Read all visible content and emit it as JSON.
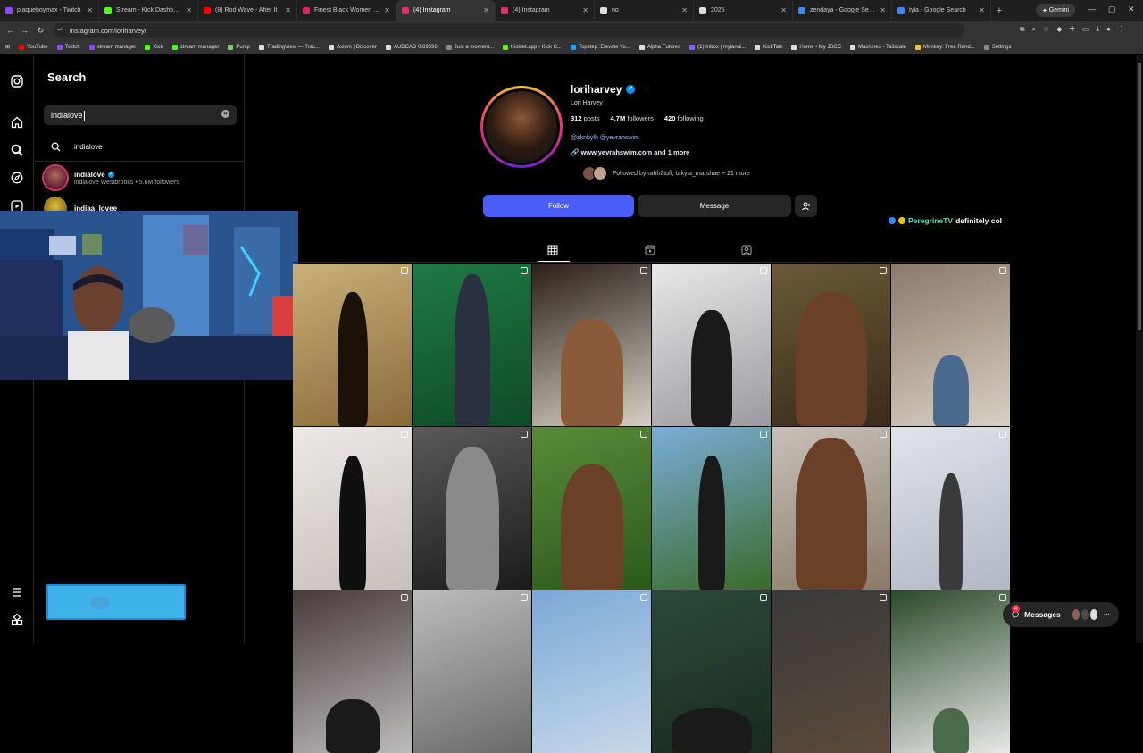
{
  "browser": {
    "tabs": [
      {
        "title": "plaqueboymax - Twitch",
        "color": "#9146ff"
      },
      {
        "title": "Stream - Kick Dashboard",
        "color": "#53fc18"
      },
      {
        "title": "(8) Rod Wave - After It",
        "color": "#ff0000"
      },
      {
        "title": "Finest Black Women | UwU",
        "color": "#e0245e"
      },
      {
        "title": "(4) Instagram",
        "color": "#e1306c"
      },
      {
        "title": "(4) Instagram",
        "color": "#e1306c"
      },
      {
        "title": "rio",
        "color": "#dddddd"
      },
      {
        "title": "2025",
        "color": "#dddddd"
      },
      {
        "title": "zendaya - Google Search",
        "color": "#4285f4"
      },
      {
        "title": "tyla - Google Search",
        "color": "#4285f4"
      }
    ],
    "gemini_label": "Gemini",
    "url": "instagram.com/loriharvey/",
    "bookmarks": [
      "YouTube",
      "Twitch",
      "stream manager",
      "Kick",
      "stream manager",
      "Pump",
      "TradingView — Trac...",
      "Axiom | Discover",
      "AUDCAD 0.89596",
      "Just a moment...",
      "Kicklet.app - Kick C...",
      "Topstep: Elevate Yo...",
      "Alpha Futures",
      "(1) Inbox | mylanai...",
      "KickTalk",
      "Home - My JSCC",
      "Machines - Tailscale",
      "Monkey: Free Rand...",
      "Settings"
    ]
  },
  "search": {
    "title": "Search",
    "query": "indialove",
    "results": [
      {
        "type": "keyword",
        "name": "indialove"
      },
      {
        "type": "user",
        "name": "indialove",
        "sub": "indialove Westbrooks • 5.6M followers",
        "verified": true
      },
      {
        "type": "user",
        "name": "indiaa_lovee",
        "sub": "",
        "verified": false
      }
    ]
  },
  "profile": {
    "username": "loriharvey",
    "full_name": "Lori Harvey",
    "posts": "312",
    "posts_label": "posts",
    "followers": "4.7M",
    "followers_label": "followers",
    "following": "420",
    "following_label": "following",
    "mentions": "@sknbylh @yevrahswim",
    "link": "www.yevrahswim.com and 1 more",
    "followed_by": "Followed by rahh2tuff, takyla_marshae + 21 more",
    "follow_label": "Follow",
    "message_label": "Message"
  },
  "overlay": {
    "name": "PeregrineTV",
    "message": "definitely col"
  },
  "messages_label": "Messages",
  "messages_count": "4",
  "colors": {
    "follow_blue": "#4a5df9",
    "verified_blue": "#0095f6",
    "badge_red": "#ff3040"
  }
}
